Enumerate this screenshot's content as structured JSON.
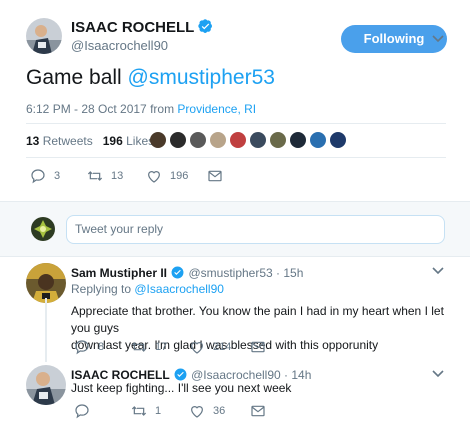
{
  "tweet": {
    "author_name": "ISAAC ROCHELL",
    "author_handle": "@Isaacrochell90",
    "follow_label": "Following",
    "text_prefix": "Game ball ",
    "text_mention": "@smustipher53",
    "timestamp": "6:12 PM - 28 Oct 2017 from ",
    "location": "Providence, RI",
    "retweets_count": "13",
    "retweets_label": "Retweets",
    "likes_count": "196",
    "likes_label": "Likes",
    "actions": {
      "replies": "3",
      "retweets": "13",
      "likes": "196"
    }
  },
  "reply_box": {
    "placeholder": "Tweet your reply"
  },
  "replies": [
    {
      "name": "Sam Mustipher II",
      "handle": "@smustipher53 · 15h",
      "replying_prefix": "Replying to ",
      "replying_handle": "@Isaacrochell90",
      "text_line1": "Appreciate that brother. You know the pain I had in my heart when I let you guys",
      "text_line2": "down last year. I'm glad I was blessed with this opporunity",
      "actions": {
        "replies": "8",
        "retweets": "17",
        "likes": "214"
      }
    },
    {
      "name": "ISAAC ROCHELL",
      "handle": "@Isaacrochell90 · 14h",
      "text_line1": "Just keep fighting... I'll see you next week",
      "actions": {
        "replies": "",
        "retweets": "1",
        "likes": "36"
      }
    }
  ],
  "icons": [
    "verified-badge-icon",
    "chevron-down-icon",
    "reply-icon",
    "retweet-icon",
    "like-icon",
    "message-icon"
  ],
  "colors": {
    "accent": "#1da1f2",
    "button": "#4aa0eb",
    "muted": "#657786",
    "text": "#14171a"
  }
}
